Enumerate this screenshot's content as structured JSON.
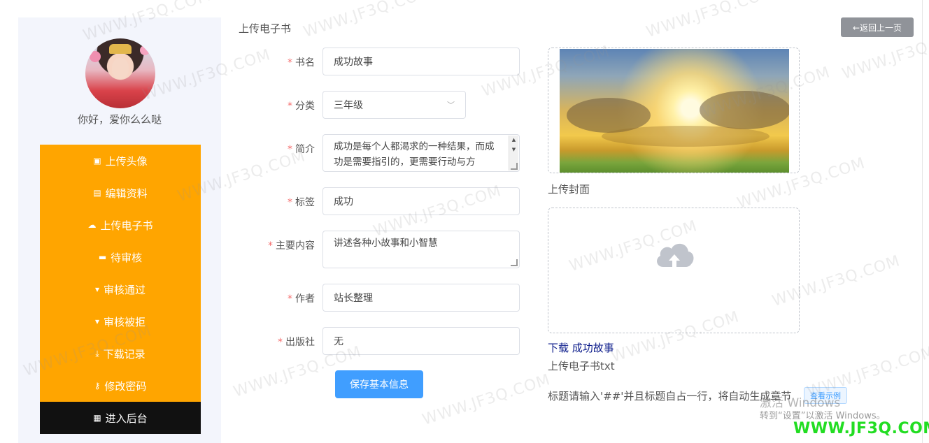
{
  "sidebar": {
    "greeting": "你好，爱你么么哒",
    "menu": [
      {
        "icon": "image-icon",
        "glyph": "▣",
        "label": "上传头像"
      },
      {
        "icon": "clipboard-icon",
        "glyph": "▤",
        "label": "编辑资料"
      },
      {
        "icon": "cloud-upload-icon",
        "glyph": "☁",
        "label": "上传电子书"
      },
      {
        "icon": "briefcase-icon",
        "glyph": "▬",
        "label": "待审核"
      },
      {
        "icon": "thumbs-up-icon",
        "glyph": "▾",
        "label": "审核通过"
      },
      {
        "icon": "thumbs-down-icon",
        "glyph": "▾",
        "label": "审核被拒"
      },
      {
        "icon": "download-icon",
        "glyph": "⤓",
        "label": "下载记录"
      },
      {
        "icon": "key-icon",
        "glyph": "⚷",
        "label": "修改密码"
      },
      {
        "icon": "grid-icon",
        "glyph": "▦",
        "label": "进入后台"
      }
    ],
    "accent_color": "#ffa500",
    "active_color": "#111111"
  },
  "page": {
    "heading": "上传电子书",
    "back_button": "←返回上一页"
  },
  "form": {
    "title": {
      "label": "书名",
      "value": "成功故事"
    },
    "category": {
      "label": "分类",
      "value": "三年级"
    },
    "intro": {
      "label": "简介",
      "value": "成功是每个人都渴求的一种结果，而成功是需要指引的，更需要行动与方"
    },
    "tags": {
      "label": "标签",
      "value": "成功"
    },
    "content": {
      "label": "主要内容",
      "value": "讲述各种小故事和小智慧"
    },
    "author": {
      "label": "作者",
      "value": "站长整理"
    },
    "publisher": {
      "label": "出版社",
      "value": "无"
    },
    "required_mark": "*",
    "save_button": "保存基本信息"
  },
  "upload": {
    "cover_caption": "上传封面",
    "download_link": "下载 成功故事",
    "txt_caption": "上传电子书txt",
    "hint": "标题请输入'##'并且标题自占一行，将自动生成章节",
    "example_tag": "查看示例"
  },
  "overlay": {
    "activate_line1": "激活 Windows",
    "activate_line2": "转到“设置”以激活 Windows。",
    "site_mark": "WWW.JF3Q.COM",
    "watermark": "WWW.JF3Q.COM"
  }
}
